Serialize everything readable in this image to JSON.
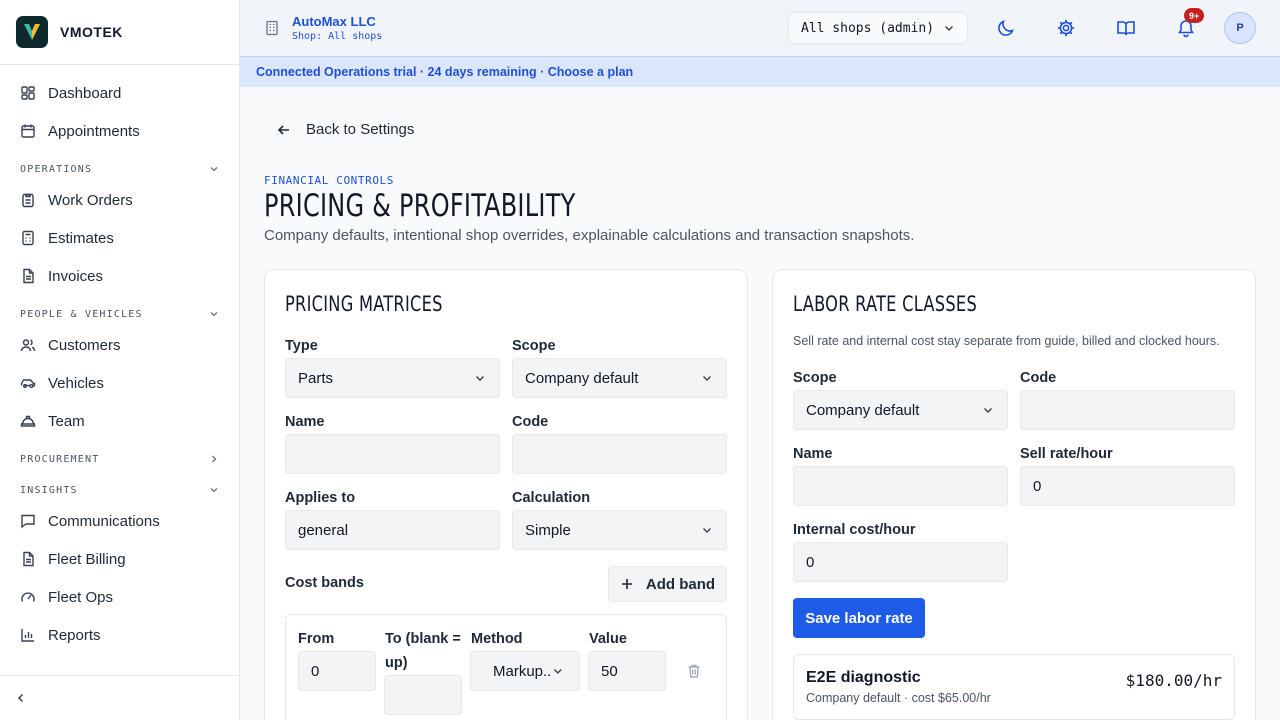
{
  "brand": {
    "name": "VMOTEK"
  },
  "nav": {
    "dashboard": "Dashboard",
    "appointments": "Appointments",
    "operations": "OPERATIONS",
    "work_orders": "Work Orders",
    "estimates": "Estimates",
    "invoices": "Invoices",
    "people_vehicles": "PEOPLE & VEHICLES",
    "customers": "Customers",
    "vehicles": "Vehicles",
    "team": "Team",
    "procurement": "PROCUREMENT",
    "insights": "INSIGHTS",
    "communications": "Communications",
    "fleet_billing": "Fleet Billing",
    "fleet_ops": "Fleet Ops",
    "reports": "Reports"
  },
  "topbar": {
    "org_name": "AutoMax LLC",
    "shop": "Shop: All shops",
    "shop_selector": "All shops (admin)",
    "notification_badge": "9+",
    "avatar_initial": "P"
  },
  "trial_banner": "Connected Operations trial · 24 days remaining · Choose a plan",
  "page": {
    "back_link": "Back to Settings",
    "eyebrow": "FINANCIAL CONTROLS",
    "title": "PRICING & PROFITABILITY",
    "subtitle": "Company defaults, intentional shop overrides, explainable calculations and transaction snapshots."
  },
  "pricing_matrices": {
    "title": "PRICING MATRICES",
    "type_label": "Type",
    "type_value": "Parts",
    "scope_label": "Scope",
    "scope_value": "Company default",
    "name_label": "Name",
    "name_value": "",
    "code_label": "Code",
    "code_value": "",
    "applies_to_label": "Applies to",
    "applies_to_value": "general",
    "calculation_label": "Calculation",
    "calculation_value": "Simple",
    "cost_bands_label": "Cost bands",
    "add_band_label": "Add band",
    "band": {
      "from_label": "From",
      "from_value": "0",
      "to_label": "To (blank = up)",
      "to_value": "",
      "method_label": "Method",
      "method_value": "Markup..",
      "value_label": "Value",
      "value_value": "50"
    }
  },
  "labor_rate_classes": {
    "title": "LABOR RATE CLASSES",
    "description": "Sell rate and internal cost stay separate from guide, billed and clocked hours.",
    "scope_label": "Scope",
    "scope_value": "Company default",
    "code_label": "Code",
    "code_value": "",
    "name_label": "Name",
    "name_value": "",
    "sell_rate_label": "Sell rate/hour",
    "sell_rate_value": "0",
    "internal_cost_label": "Internal cost/hour",
    "internal_cost_value": "0",
    "save_label": "Save labor rate",
    "rates": [
      {
        "name": "E2E diagnostic",
        "meta": "Company default · cost $65.00/hr",
        "rate": "$180.00/hr"
      }
    ]
  },
  "colors": {
    "accent": "#1e5be6",
    "link": "#1e4fd8",
    "badge": "#c81e1e",
    "banner": "#dbe6fb"
  }
}
